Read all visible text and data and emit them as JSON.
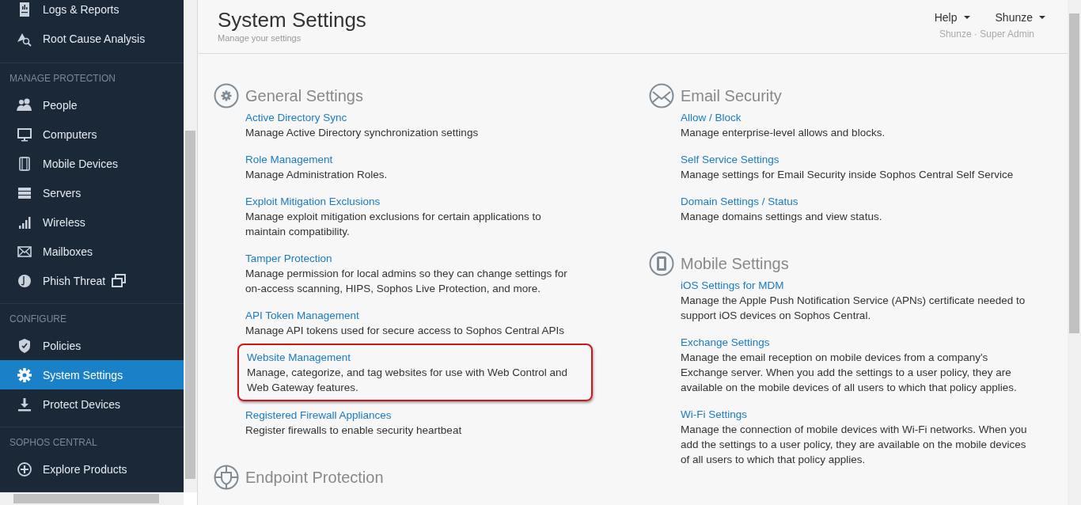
{
  "sidebar": {
    "sections": [
      {
        "items": [
          {
            "label": "Logs & Reports",
            "selected": false,
            "external": false
          },
          {
            "label": "Root Cause Analysis",
            "selected": false,
            "external": false
          }
        ]
      },
      {
        "heading": "MANAGE PROTECTION",
        "items": [
          {
            "label": "People",
            "selected": false,
            "external": false
          },
          {
            "label": "Computers",
            "selected": false,
            "external": false
          },
          {
            "label": "Mobile Devices",
            "selected": false,
            "external": false
          },
          {
            "label": "Servers",
            "selected": false,
            "external": false
          },
          {
            "label": "Wireless",
            "selected": false,
            "external": false
          },
          {
            "label": "Mailboxes",
            "selected": false,
            "external": false
          },
          {
            "label": "Phish Threat",
            "selected": false,
            "external": true
          }
        ]
      },
      {
        "heading": "CONFIGURE",
        "items": [
          {
            "label": "Policies",
            "selected": false,
            "external": false
          },
          {
            "label": "System Settings",
            "selected": true,
            "external": false
          },
          {
            "label": "Protect Devices",
            "selected": false,
            "external": false
          }
        ]
      },
      {
        "heading": "SOPHOS CENTRAL",
        "items": [
          {
            "label": "Explore Products",
            "selected": false,
            "external": false
          }
        ]
      }
    ]
  },
  "header": {
    "title": "System Settings",
    "subtitle": "Manage your settings",
    "menus": [
      "Help",
      "Shunze"
    ],
    "user_role": "Shunze · Super Admin"
  },
  "columns": [
    [
      {
        "title": "General Settings",
        "items": [
          {
            "link": "Active Directory Sync",
            "description": "Manage Active Directory synchronization settings",
            "highlighted": false
          },
          {
            "link": "Role Management",
            "description": "Manage Administration Roles.",
            "highlighted": false
          },
          {
            "link": "Exploit Mitigation Exclusions",
            "description": "Manage exploit mitigation exclusions for certain applications to maintain compatibility.",
            "highlighted": false
          },
          {
            "link": "Tamper Protection",
            "description": "Manage permission for local admins so they can change settings for on-access scanning, HIPS, Sophos Live Protection, and more.",
            "highlighted": false
          },
          {
            "link": "API Token Management",
            "description": "Manage API tokens used for secure access to Sophos Central APIs",
            "highlighted": false
          },
          {
            "link": "Website Management",
            "description": "Manage, categorize, and tag websites for use with Web Control and Web Gateway features.",
            "highlighted": true
          },
          {
            "link": "Registered Firewall Appliances",
            "description": "Register firewalls to enable security heartbeat",
            "highlighted": false
          }
        ]
      },
      {
        "title": "Endpoint Protection"
      }
    ],
    [
      {
        "title": "Email Security",
        "items": [
          {
            "link": "Allow / Block",
            "description": "Manage enterprise-level allows and blocks.",
            "highlighted": false
          },
          {
            "link": "Self Service Settings",
            "description": "Manage settings for Email Security inside Sophos Central Self Service",
            "highlighted": false
          },
          {
            "link": "Domain Settings / Status",
            "description": "Manage domains settings and view status.",
            "highlighted": false
          }
        ]
      },
      {
        "title": "Mobile Settings",
        "items": [
          {
            "link": "iOS Settings for MDM",
            "description": "Manage the Apple Push Notification Service (APNs) certificate needed to support iOS devices on Sophos Central.",
            "highlighted": false
          },
          {
            "link": "Exchange Settings",
            "description": "Manage the email reception on mobile devices from a company's Exchange server. When you add the settings to a user policy, they are available on the mobile devices of all users to which that policy applies.",
            "highlighted": false
          },
          {
            "link": "Wi-Fi Settings",
            "description": "Manage the connection of mobile devices with Wi-Fi networks. When you add the settings to a user policy, they are available on the mobile devices of all users to which that policy applies.",
            "highlighted": false
          }
        ]
      }
    ]
  ]
}
